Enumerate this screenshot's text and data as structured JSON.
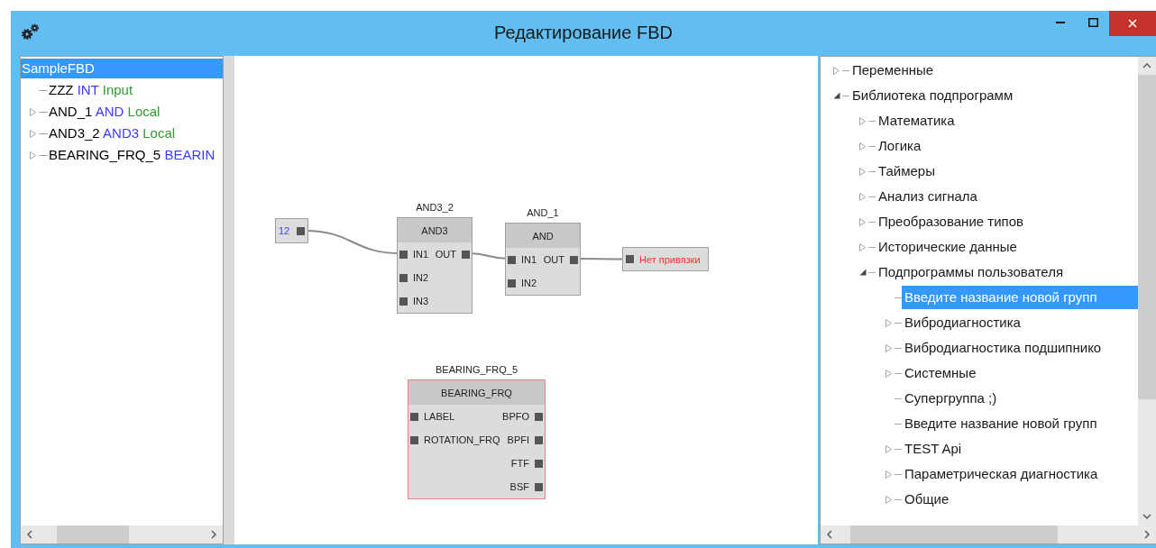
{
  "window": {
    "title": "Редактирование FBD"
  },
  "object_tree": {
    "items": [
      {
        "name": "SampleFBD",
        "selected": true,
        "children": [
          {
            "name": "ZZZ",
            "type": "INT",
            "scope": "Input",
            "selected": false
          },
          {
            "name": "AND_1",
            "type": "AND",
            "scope": "Local",
            "selected": false,
            "expanded": false
          },
          {
            "name": "AND3_2",
            "type": "AND3",
            "scope": "Local",
            "selected": false,
            "expanded": false
          },
          {
            "name": "BEARING_FRQ_5",
            "type": "BEARIN",
            "selected": false,
            "expanded": false
          }
        ]
      }
    ]
  },
  "diagram": {
    "blocks": [
      {
        "kind": "constant",
        "value": "12",
        "selected": false
      },
      {
        "kind": "block",
        "caption": "AND3_2",
        "type": "AND3",
        "selected": false,
        "inputs": [
          "IN1",
          "IN2",
          "IN3"
        ],
        "outputs": [
          "OUT"
        ]
      },
      {
        "kind": "block",
        "caption": "AND_1",
        "type": "AND",
        "selected": false,
        "inputs": [
          "IN1",
          "IN2"
        ],
        "outputs": [
          "OUT"
        ]
      },
      {
        "kind": "output",
        "label": "Нет привязки",
        "selected": false
      },
      {
        "kind": "block",
        "caption": "BEARING_FRQ_5",
        "type": "BEARING_FRQ",
        "selected": true,
        "inputs": [
          "LABEL",
          "ROTATION_FRQ"
        ],
        "outputs": [
          "BPFO",
          "BPFI",
          "FTF",
          "BSF"
        ]
      }
    ]
  },
  "library_tree": {
    "items": [
      {
        "label": "Переменные",
        "expanded": false,
        "selected": false
      },
      {
        "label": "Библиотека подпрограмм",
        "expanded": true,
        "selected": false,
        "children": [
          {
            "label": "Математика",
            "expanded": false,
            "selected": false
          },
          {
            "label": "Логика",
            "expanded": false,
            "selected": false
          },
          {
            "label": "Таймеры",
            "expanded": false,
            "selected": false
          },
          {
            "label": "Анализ сигнала",
            "expanded": false,
            "selected": false
          },
          {
            "label": "Преобразование типов",
            "expanded": false,
            "selected": false
          },
          {
            "label": "Исторические данные",
            "expanded": false,
            "selected": false
          },
          {
            "label": "Подпрограммы пользователя",
            "expanded": true,
            "selected": false,
            "children": [
              {
                "label": "Введите название новой групп",
                "selected": true
              },
              {
                "label": "Вибродиагностика",
                "expanded": false,
                "selected": false
              },
              {
                "label": "Вибродиагностика подшипнико",
                "expanded": false,
                "selected": false
              },
              {
                "label": "Системные",
                "expanded": false,
                "selected": false
              },
              {
                "label": "Супергруппа ;)",
                "selected": false
              },
              {
                "label": "Введите название новой групп",
                "selected": false
              },
              {
                "label": "TEST Api",
                "expanded": false,
                "selected": false
              },
              {
                "label": "Параметрическая диагностика",
                "expanded": false,
                "selected": false
              },
              {
                "label": "Общие",
                "expanded": false,
                "selected": false
              }
            ]
          }
        ]
      }
    ]
  }
}
